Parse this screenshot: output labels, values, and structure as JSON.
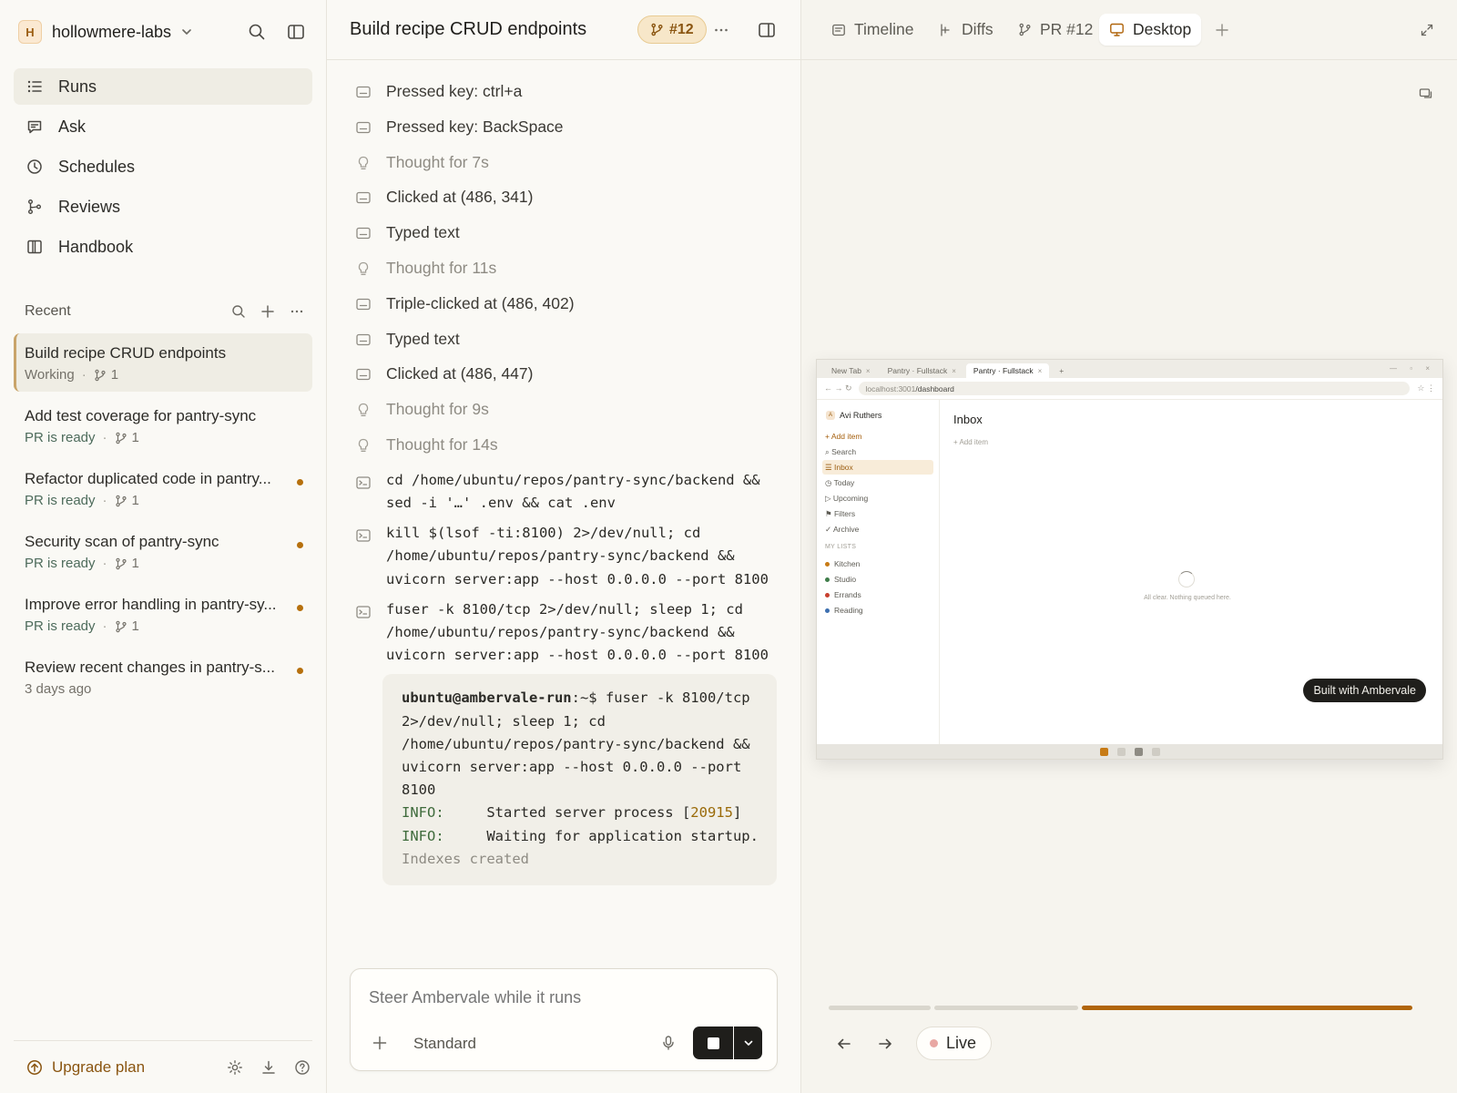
{
  "sidebar": {
    "workspace": {
      "initial": "H",
      "name": "hollowmere-labs"
    },
    "nav": [
      {
        "label": "Runs",
        "icon": "list-icon",
        "active": true
      },
      {
        "label": "Ask",
        "icon": "chat-icon",
        "active": false
      },
      {
        "label": "Schedules",
        "icon": "clock-icon",
        "active": false
      },
      {
        "label": "Reviews",
        "icon": "branch-icon",
        "active": false
      },
      {
        "label": "Handbook",
        "icon": "book-icon",
        "active": false
      }
    ],
    "recent_title": "Recent",
    "recent": [
      {
        "title": "Build recipe CRUD endpoints",
        "status": "Working",
        "pr_count": "1",
        "dot": false,
        "active": true
      },
      {
        "title": "Add test coverage for pantry-sync",
        "status": "PR is ready",
        "pr_count": "1",
        "dot": false
      },
      {
        "title": "Refactor duplicated code in pantry...",
        "status": "PR is ready",
        "pr_count": "1",
        "dot": true
      },
      {
        "title": "Security scan of pantry-sync",
        "status": "PR is ready",
        "pr_count": "1",
        "dot": true
      },
      {
        "title": "Improve error handling in pantry-sy...",
        "status": "PR is ready",
        "pr_count": "1",
        "dot": true
      },
      {
        "title": "Review recent changes in pantry-s...",
        "status": "3 days ago",
        "pr_count": "",
        "dot": true
      }
    ],
    "upgrade_label": "Upgrade plan"
  },
  "run": {
    "title": "Build recipe CRUD endpoints",
    "pr_badge": "#12",
    "steps": [
      {
        "kind": "action",
        "text": "Pressed key: ctrl+a"
      },
      {
        "kind": "action",
        "text": "Pressed key: BackSpace"
      },
      {
        "kind": "thought",
        "text": "Thought for 7s"
      },
      {
        "kind": "action",
        "text": "Clicked at (486, 341)"
      },
      {
        "kind": "action",
        "text": "Typed text"
      },
      {
        "kind": "thought",
        "text": "Thought for 11s"
      },
      {
        "kind": "action",
        "text": "Triple-clicked at (486, 402)"
      },
      {
        "kind": "action",
        "text": "Typed text"
      },
      {
        "kind": "action",
        "text": "Clicked at (486, 447)"
      },
      {
        "kind": "thought",
        "text": "Thought for 9s"
      },
      {
        "kind": "thought",
        "text": "Thought for 14s"
      }
    ],
    "commands": [
      "cd /home/ubuntu/repos/pantry-sync/backend && sed -i '…' .env && cat .env",
      "kill $(lsof -ti:8100) 2>/dev/null; cd /home/ubuntu/repos/pantry-sync/backend && uvicorn server:app --host 0.0.0.0 --port 8100",
      "fuser -k 8100/tcp 2>/dev/null; sleep 1; cd /home/ubuntu/repos/pantry-sync/backend && uvicorn server:app --host 0.0.0.0 --port 8100"
    ],
    "terminal": {
      "prompt_user": "ubuntu@ambervale-run",
      "prompt_path": ":~$",
      "command": " fuser -k 8100/tcp 2>/dev/null; sleep 1; cd /home/ubuntu/repos/pantry-sync/backend && uvicorn server:app --host 0.0.0.0 --port 8100",
      "line1_label": "INFO:",
      "line1_text": "     Started server process [",
      "line1_pid": "20915",
      "line1_end": "]",
      "line2_label": "INFO:",
      "line2_text": "     Waiting for application startup.",
      "line3": "Indexes created"
    },
    "composer": {
      "placeholder": "Steer Ambervale while it runs",
      "mode": "Standard"
    }
  },
  "viewer": {
    "tabs": [
      {
        "label": "Timeline",
        "icon": "timeline-icon",
        "active": false
      },
      {
        "label": "Diffs",
        "icon": "diff-icon",
        "active": false
      },
      {
        "label": "PR #12",
        "icon": "pull-request-icon",
        "active": false
      },
      {
        "label": "Desktop",
        "icon": "monitor-icon",
        "active": true
      }
    ],
    "desktop": {
      "browser_tabs": [
        {
          "label": "New Tab",
          "active": false
        },
        {
          "label": "Pantry · Fullstack",
          "active": false
        },
        {
          "label": "Pantry · Fullstack",
          "active": true
        }
      ],
      "url_host": "localhost:3001",
      "url_path": "/dashboard",
      "user_initial": "A",
      "user_name": "Avi Ruthers",
      "side_items": [
        {
          "label": "+ Add item",
          "style": "add"
        },
        {
          "label": "⌕ Search",
          "style": ""
        },
        {
          "label": "☰ Inbox",
          "style": "active"
        },
        {
          "label": "◷ Today",
          "style": ""
        },
        {
          "label": "▷ Upcoming",
          "style": ""
        },
        {
          "label": "⚑ Filters",
          "style": ""
        },
        {
          "label": "✓ Archive",
          "style": ""
        }
      ],
      "lists_header": "MY LISTS",
      "lists": [
        {
          "label": "Kitchen",
          "color": "#c77b16"
        },
        {
          "label": "Studio",
          "color": "#3f7d4a"
        },
        {
          "label": "Errands",
          "color": "#c8402f"
        },
        {
          "label": "Reading",
          "color": "#3d6fb0"
        }
      ],
      "main_title": "Inbox",
      "add_item": "+ Add item",
      "empty_text": "All clear. Nothing queued here.",
      "built_badge": "Built with Ambervale",
      "dock_colors": [
        "#c77b16",
        "#cfccc4",
        "#8e8b83",
        "#cfccc4"
      ]
    },
    "progress_segments": [
      {
        "fraction": 0.17,
        "color": "#d9d6cd"
      },
      {
        "fraction": 0.24,
        "color": "#d9d6cd"
      },
      {
        "fraction": 0.55,
        "color": "#b0650c"
      }
    ],
    "live_label": "Live",
    "colors": {
      "accent": "#b0650c",
      "live_dot": "#e8a7a3"
    }
  }
}
